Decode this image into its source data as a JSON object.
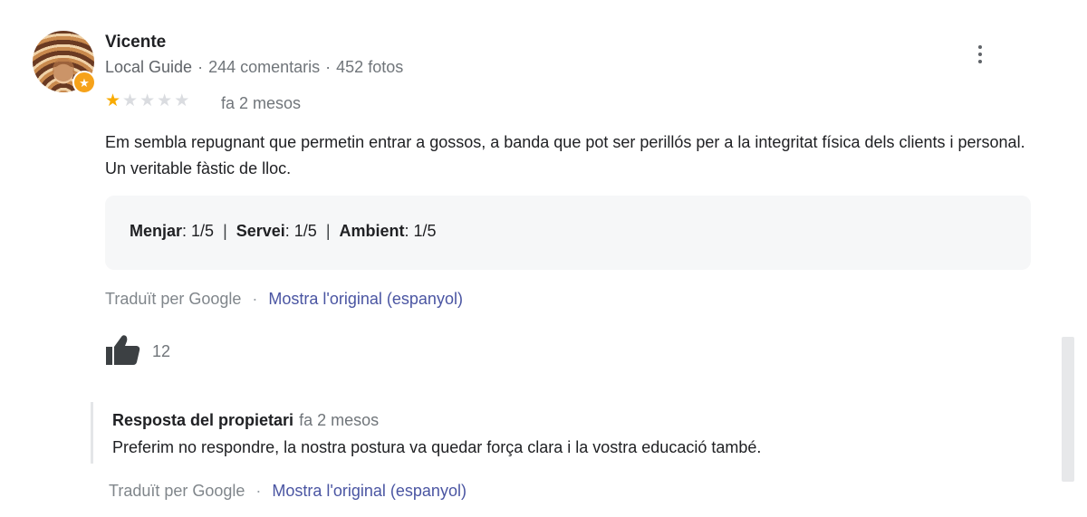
{
  "review": {
    "author": "Vicente",
    "author_role": "Local Guide",
    "reviews_count": "244 comentaris",
    "photos_count": "452 fotos",
    "rating": 1,
    "max_rating": 5,
    "date": "fa 2 mesos",
    "text": "Em sembla repugnant que permetin entrar a gossos, a banda que pot ser perillós per a la integritat física dels clients i personal. Un veritable fàstic de lloc.",
    "ratings": [
      {
        "label": "Menjar",
        "value": ": 1/5"
      },
      {
        "label": "Servei",
        "value": ": 1/5"
      },
      {
        "label": "Ambient",
        "value": ": 1/5"
      }
    ],
    "translated_label": "Traduït per Google",
    "show_original_label": "Mostra l'original (espanyol)",
    "likes": "12"
  },
  "owner_reply": {
    "title": "Resposta del propietari",
    "date": "fa 2 mesos",
    "text": "Preferim no respondre, la nostra postura va quedar força clara i la vostra educació també.",
    "translated_label": "Traduït per Google",
    "show_original_label": "Mostra l'original (espanyol)"
  },
  "icons": {
    "more": "more-vert-icon",
    "like": "thumbs-up-icon",
    "guide_badge": "local-guide-star-icon"
  },
  "colors": {
    "star_filled": "#f9ab00",
    "star_empty": "#dadce0",
    "link": "#4a55a2",
    "badge": "#f6a21a"
  }
}
